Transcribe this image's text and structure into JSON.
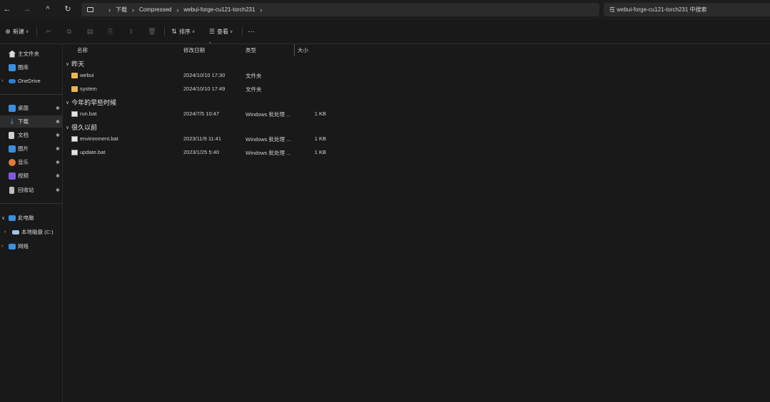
{
  "nav": {
    "back": "←",
    "forward": "→",
    "up": "^",
    "refresh": "↻"
  },
  "address": {
    "crumbs": [
      "下载",
      "Compressed",
      "webui-forge-cu121-torch231"
    ],
    "separator": "›"
  },
  "search": {
    "placeholder": "在 webui-forge-cu121-torch231 中搜索"
  },
  "toolbar": {
    "new_label": "新建",
    "sort_label": "排序",
    "view_label": "查看",
    "more_label": "···"
  },
  "sidebar": {
    "items": [
      {
        "label": "主文件夹",
        "icon": "home-icon",
        "color": "#d9d9d9"
      },
      {
        "label": "图库",
        "icon": "gallery-icon",
        "color": "#3b8ee0"
      },
      {
        "label": "OneDrive",
        "icon": "cloud-icon",
        "color": "#2f7fd8"
      },
      {
        "label": "桌面",
        "icon": "desktop-icon",
        "color": "#3b8ee0"
      },
      {
        "label": "下载",
        "icon": "download-icon",
        "color": "#3bb0e0"
      },
      {
        "label": "文档",
        "icon": "document-icon",
        "color": "#cfcfcf"
      },
      {
        "label": "图片",
        "icon": "picture-icon",
        "color": "#3b8ee0"
      },
      {
        "label": "音乐",
        "icon": "music-icon",
        "color": "#e07b3b"
      },
      {
        "label": "视频",
        "icon": "video-icon",
        "color": "#7b5ce0"
      },
      {
        "label": "回收站",
        "icon": "recycle-bin-icon",
        "color": "#bdbdbd"
      },
      {
        "label": "此电脑",
        "icon": "computer-icon",
        "color": "#3b8ee0"
      },
      {
        "label": "本地磁盘 (C:)",
        "icon": "drive-icon",
        "color": "#9ec4e8"
      },
      {
        "label": "网络",
        "icon": "network-icon",
        "color": "#3b8ee0"
      }
    ]
  },
  "columns": {
    "name": "名称",
    "date": "修改日期",
    "type": "类型",
    "size": "大小"
  },
  "groups": [
    {
      "label": "昨天",
      "rows": [
        {
          "name": "webui",
          "date": "2024/10/10 17:30",
          "type": "文件夹",
          "size": "",
          "kind": "folder"
        },
        {
          "name": "system",
          "date": "2024/10/10 17:49",
          "type": "文件夹",
          "size": "",
          "kind": "folder"
        }
      ]
    },
    {
      "label": "今年的早些时候",
      "rows": [
        {
          "name": "run.bat",
          "date": "2024/7/5 10:47",
          "type": "Windows 批处理 ...",
          "size": "1 KB",
          "kind": "bat"
        }
      ]
    },
    {
      "label": "很久以前",
      "rows": [
        {
          "name": "environment.bat",
          "date": "2023/11/9 11:41",
          "type": "Windows 批处理 ...",
          "size": "1 KB",
          "kind": "bat"
        },
        {
          "name": "update.bat",
          "date": "2023/1/25 5:40",
          "type": "Windows 批处理 ...",
          "size": "1 KB",
          "kind": "bat"
        }
      ]
    }
  ]
}
